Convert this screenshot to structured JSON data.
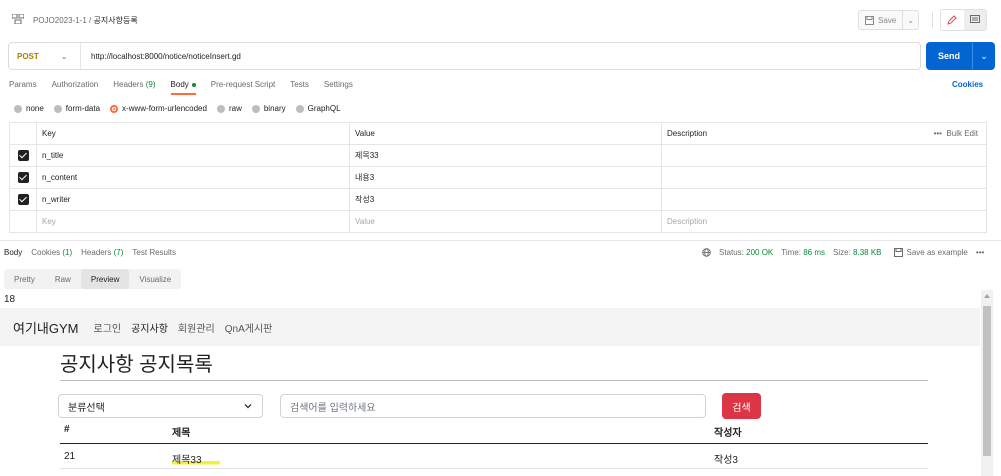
{
  "topbar": {
    "collection": "POJO2023-1-1",
    "separator": "/",
    "request_name": "공지사항등록",
    "save_label": "Save"
  },
  "request": {
    "method": "POST",
    "url": "http://localhost:8000/notice/noticeInsert.gd",
    "send_label": "Send"
  },
  "req_tabs": {
    "params": "Params",
    "authorization": "Authorization",
    "headers": "Headers",
    "headers_count": "(9)",
    "body": "Body",
    "prerequest": "Pre-request Script",
    "tests": "Tests",
    "settings": "Settings",
    "cookies": "Cookies"
  },
  "body_types": [
    "none",
    "form-data",
    "x-www-form-urlencoded",
    "raw",
    "binary",
    "GraphQL"
  ],
  "params_table": {
    "headers": {
      "key": "Key",
      "value": "Value",
      "description": "Description",
      "bulk": "Bulk Edit",
      "more": "•••"
    },
    "rows": [
      {
        "key": "n_title",
        "value": "제목33"
      },
      {
        "key": "n_content",
        "value": "내용3"
      },
      {
        "key": "n_writer",
        "value": "작성3"
      }
    ],
    "placeholder": {
      "key": "Key",
      "value": "Value",
      "description": "Description"
    }
  },
  "response": {
    "tabs": {
      "body": "Body",
      "cookies": "Cookies",
      "cookies_count": "(1)",
      "headers": "Headers",
      "headers_count": "(7)",
      "tests": "Test Results"
    },
    "status_label": "Status:",
    "status": "200 OK",
    "time_label": "Time:",
    "time": "86 ms",
    "size_label": "Size:",
    "size": "8.38 KB",
    "save_example": "Save as example",
    "more": "•••",
    "view_tabs": [
      "Pretty",
      "Raw",
      "Preview",
      "Visualize"
    ],
    "line_number": "18"
  },
  "preview": {
    "brand": "여기내GYM",
    "nav": [
      "로그인",
      "공지사항",
      "회원관리",
      "QnA게시판"
    ],
    "title": "공지사항 공지목록",
    "select_value": "분류선택",
    "search_placeholder": "검색어를 입력하세요",
    "search_button": "검색",
    "columns": {
      "num": "#",
      "title": "제목",
      "writer": "작성자"
    },
    "rows": [
      {
        "num": "21",
        "title": "제목33",
        "writer": "작성3"
      }
    ]
  },
  "colors": {
    "send": "#0265d2",
    "method": "#ad7a03",
    "active_tab": "#ff6c37",
    "status_ok": "#0b8a3a",
    "search_button": "#dc3545",
    "highlight": "#f4f03a"
  }
}
